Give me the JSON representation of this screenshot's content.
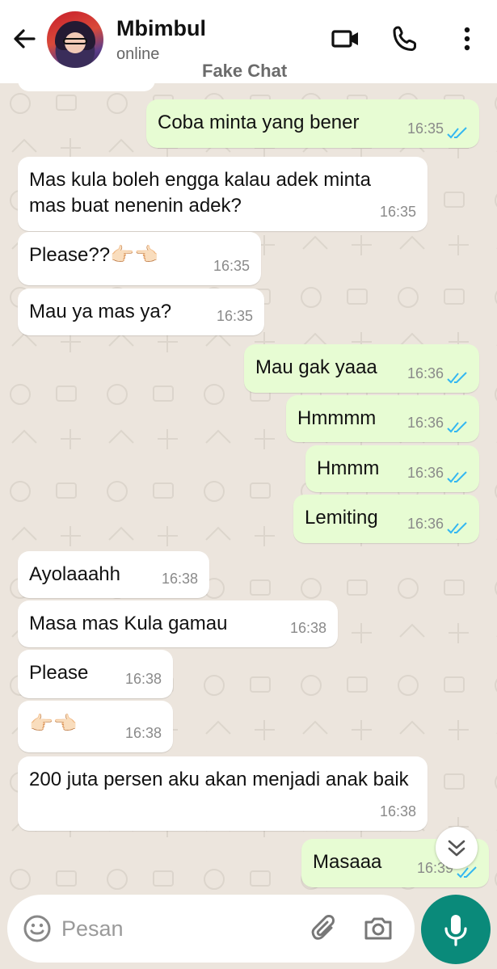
{
  "header": {
    "contact_name": "Mbimbul",
    "status": "online",
    "watermark": "Fake Chat"
  },
  "messages": [
    {
      "dir": "out",
      "text": "Coba minta yang bener",
      "time": "16:35"
    },
    {
      "dir": "in",
      "text": "Mas kula boleh engga kalau adek minta mas buat nenenin adek?",
      "time": "16:35"
    },
    {
      "dir": "in",
      "text": "Please??👉🏻👈🏻",
      "time": "16:35"
    },
    {
      "dir": "in",
      "text": "Mau ya mas ya?",
      "time": "16:35"
    },
    {
      "dir": "out",
      "text": "Mau gak yaaa",
      "time": "16:36"
    },
    {
      "dir": "out",
      "text": "Hmmmm",
      "time": "16:36"
    },
    {
      "dir": "out",
      "text": "Hmmm",
      "time": "16:36"
    },
    {
      "dir": "out",
      "text": "Lemiting",
      "time": "16:36"
    },
    {
      "dir": "in",
      "text": "Ayolaaahh",
      "time": "16:38"
    },
    {
      "dir": "in",
      "text": "Masa mas Kula gamau",
      "time": "16:38"
    },
    {
      "dir": "in",
      "text": "Please",
      "time": "16:38"
    },
    {
      "dir": "in",
      "text": "👉🏻👈🏻",
      "time": "16:38"
    },
    {
      "dir": "in",
      "text": "200 juta persen aku akan menjadi anak baik",
      "time": "16:38"
    },
    {
      "dir": "out",
      "text": "Masaaa",
      "time": "16:39"
    }
  ],
  "composer": {
    "placeholder": "Pesan"
  },
  "colors": {
    "outgoing_bubble": "#e7fcd3",
    "incoming_bubble": "#ffffff",
    "read_ticks": "#34b7f1",
    "mic_button": "#0a8a7a"
  },
  "icons": {
    "back": "arrow-left",
    "video": "video-camera",
    "call": "phone",
    "menu": "more-vertical",
    "scroll": "double-chevron-down",
    "emoji": "smiley",
    "attach": "paperclip",
    "camera": "camera",
    "mic": "microphone"
  }
}
